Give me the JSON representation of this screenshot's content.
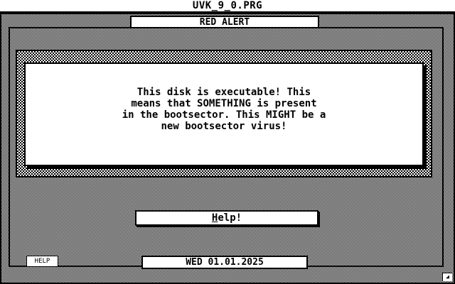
{
  "app": {
    "title": "UVK_9_0.PRG"
  },
  "dialog": {
    "title": "RED ALERT",
    "message": "This disk is executable! This\nmeans that SOMETHING is present\nin the bootsector. This MIGHT be a\nnew bootsector virus!"
  },
  "buttons": {
    "help_main_first": "H",
    "help_main_rest": "elp!",
    "help_small": "HELP"
  },
  "status": {
    "date": "WED 01.01.2025"
  },
  "icons": {
    "resize": "resize-corner-icon"
  }
}
